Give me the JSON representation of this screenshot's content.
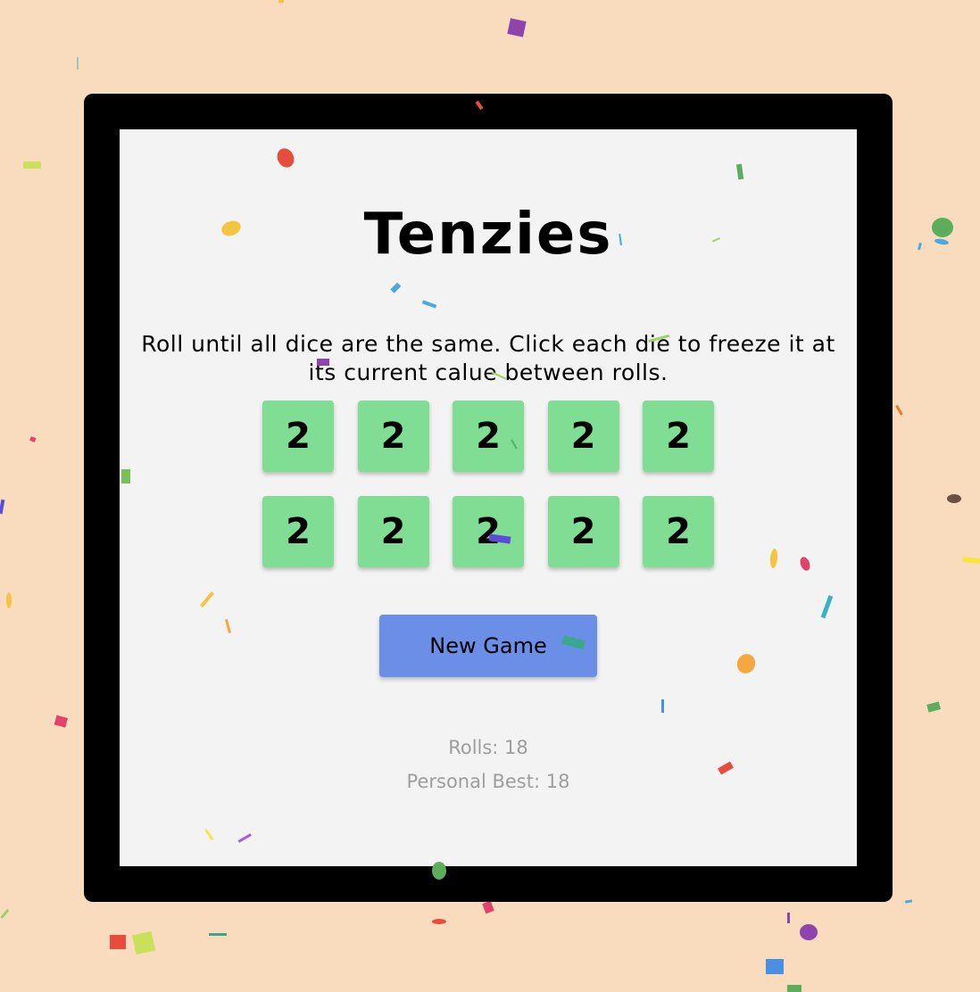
{
  "game": {
    "title": "Tenzies",
    "instructions": "Roll until all dice are the same. Click each die to freeze it at its current calue between rolls.",
    "dice": [
      2,
      2,
      2,
      2,
      2,
      2,
      2,
      2,
      2,
      2
    ],
    "new_game_label": "New Game",
    "rolls_text": "Rolls: 18",
    "best_text": "Personal Best: 18"
  },
  "colors": {
    "background": "#f8dcbd",
    "frame": "#000000",
    "board": "#f3f3f3",
    "die": "#80de94",
    "button": "#6b8fe7",
    "stats_text": "#9d9d9d"
  }
}
